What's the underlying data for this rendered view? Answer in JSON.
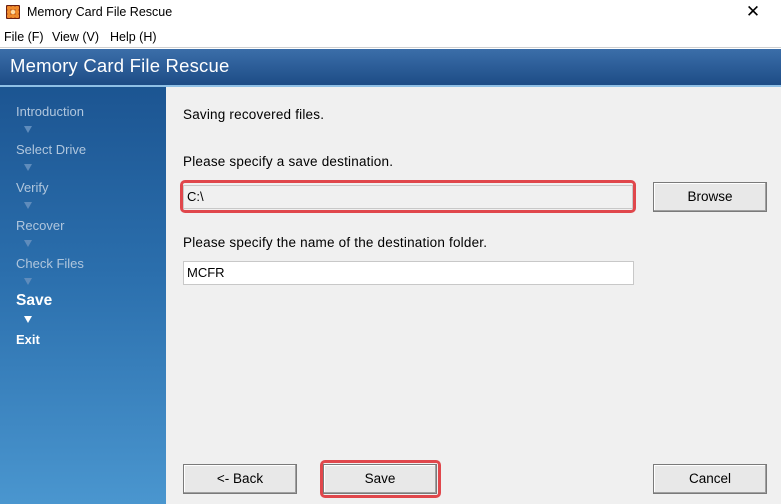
{
  "window": {
    "title": "Memory Card File Rescue",
    "close_glyph": "✕",
    "app_icon": "app-grid-icon"
  },
  "menu": {
    "file": "File (F)",
    "view": "View (V)",
    "help": "Help (H)"
  },
  "header": {
    "title": "Memory Card File Rescue"
  },
  "sidebar": {
    "steps": [
      "Introduction",
      "Select Drive",
      "Verify",
      "Recover",
      "Check Files",
      "Save",
      "Exit"
    ],
    "active_step": "Save"
  },
  "main": {
    "heading": "Saving recovered files.",
    "destination_label": "Please specify a save destination.",
    "destination_value": "C:\\",
    "browse_label": "Browse",
    "folder_label": "Please specify the name of the destination folder.",
    "folder_value": "MCFR"
  },
  "footer": {
    "back_label": "<- Back",
    "save_label": "Save",
    "cancel_label": "Cancel"
  },
  "colors": {
    "header_blue": "#1d4c86",
    "highlight_red": "#e0474c",
    "panel_bg": "#f0f0f0"
  }
}
